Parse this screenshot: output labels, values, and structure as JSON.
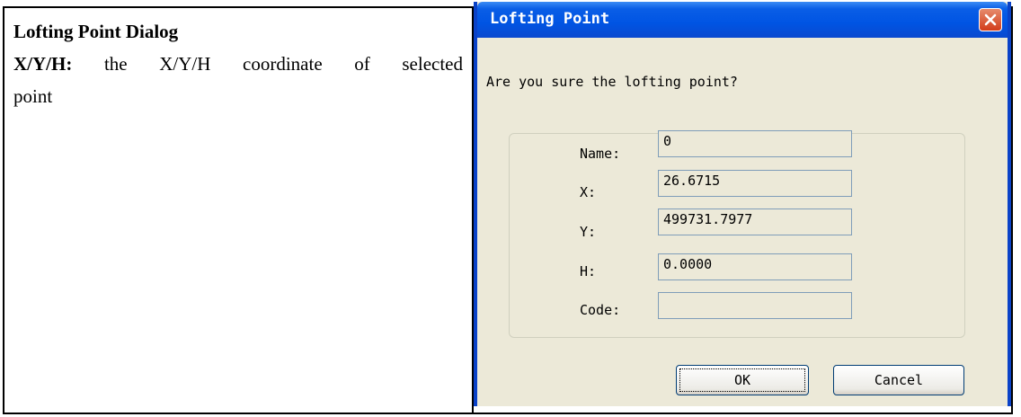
{
  "left_cell": {
    "heading": "Lofting Point Dialog",
    "desc_label": "X/Y/H:",
    "desc_text": "the X/Y/H coordinate of selected",
    "desc_text_cont": "point"
  },
  "dialog": {
    "title": "Lofting Point",
    "prompt": "Are you sure the lofting point?",
    "fields": [
      {
        "label": "Name:",
        "value": "0"
      },
      {
        "label": "X:",
        "value": "26.6715"
      },
      {
        "label": "Y:",
        "value": "499731.7977"
      },
      {
        "label": "H:",
        "value": "0.0000"
      },
      {
        "label": "Code:",
        "value": ""
      }
    ],
    "ok_label": "OK",
    "cancel_label": "Cancel",
    "colors": {
      "titlebar": "#0054e3",
      "face": "#ece9d8",
      "close": "#d23c1a"
    }
  }
}
